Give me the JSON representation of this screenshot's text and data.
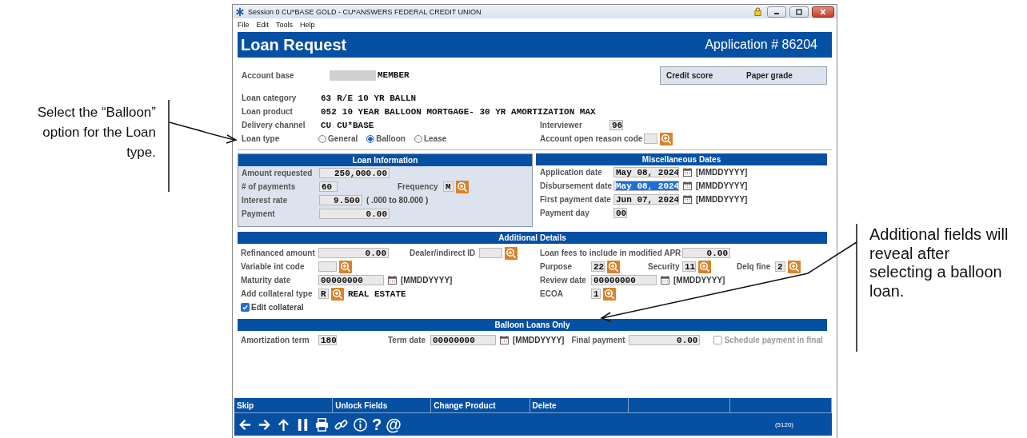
{
  "callouts": [
    {
      "text": "Select the “Balloon” option for the Loan type."
    },
    {
      "text": "Additional fields will reveal after selecting a balloon loan."
    }
  ],
  "window": {
    "title": "Session 0 CU*BASE GOLD - CU*ANSWERS FEDERAL CREDIT UNION",
    "menu": [
      "File",
      "Edit",
      "Tools",
      "Help"
    ]
  },
  "header": {
    "title": "Loan Request",
    "application": "Application # 86204"
  },
  "account_base": {
    "label": "Account base",
    "value": "MEMBER"
  },
  "credit_panel": [
    "Credit score",
    "Paper grade"
  ],
  "loan_category": {
    "label": "Loan category",
    "code": "63",
    "name": "R/E 10 YR BALLN"
  },
  "loan_product": {
    "label": "Loan product",
    "code": "052",
    "name": "10 YEAR BALLOON MORTGAGE- 30 YR AMORTIZATION MAX"
  },
  "delivery_channel": {
    "label": "Delivery channel",
    "code": "CU",
    "name": "CU*BASE"
  },
  "interviewer": {
    "label": "Interviewer",
    "value": "96"
  },
  "loan_type": {
    "label": "Loan type",
    "options": [
      {
        "label": "General",
        "selected": false
      },
      {
        "label": "Balloon",
        "selected": true
      },
      {
        "label": "Lease",
        "selected": false
      }
    ]
  },
  "account_open_reason": {
    "label": "Account open reason code"
  },
  "loan_information": {
    "title": "Loan Information",
    "amount_requested": {
      "label": "Amount requested",
      "value": "250,000.00"
    },
    "payments": {
      "label": "# of payments",
      "value": "60"
    },
    "frequency": {
      "label": "Frequency",
      "value": "M"
    },
    "interest_rate": {
      "label": "Interest rate",
      "value": "9.500",
      "range": "( .000 to 80.000 )"
    },
    "payment": {
      "label": "Payment",
      "value": "0.00"
    }
  },
  "miscellaneous_dates": {
    "title": "Miscellaneous Dates",
    "rows": [
      {
        "label": "Application date",
        "value": "May 08, 2024",
        "format": "[MMDDYYYY]",
        "selected": false
      },
      {
        "label": "Disbursement date",
        "value": "May 08, 2024",
        "format": "[MMDDYYYY]",
        "selected": true
      },
      {
        "label": "First payment date",
        "value": "Jun 07, 2024",
        "format": "[MMDDYYYY]",
        "selected": false
      }
    ],
    "payment_day": {
      "label": "Payment day",
      "value": "00"
    }
  },
  "additional_details": {
    "title": "Additional Details",
    "refinanced_amount": {
      "label": "Refinanced amount",
      "value": "0.00"
    },
    "dealer_id": {
      "label": "Dealer/indirect ID"
    },
    "loan_fees": {
      "label": "Loan fees to include in modified APR",
      "value": "0.00"
    },
    "variable_int_code": {
      "label": "Variable int code"
    },
    "purpose": {
      "label": "Purpose",
      "value": "22"
    },
    "security": {
      "label": "Security",
      "value": "11"
    },
    "delq_fine": {
      "label": "Delq fine",
      "value": "2"
    },
    "maturity_date": {
      "label": "Maturity date",
      "value": "00000000",
      "format": "[MMDDYYYY]"
    },
    "review_date": {
      "label": "Review date",
      "value": "00000000",
      "format": "[MMDDYYYY]"
    },
    "collateral_type": {
      "label": "Add collateral type",
      "value": "R",
      "description": "REAL ESTATE"
    },
    "ecoa": {
      "label": "ECOA",
      "value": "1"
    },
    "edit_collateral": {
      "label": "Edit collateral",
      "checked": true
    }
  },
  "balloon_loans": {
    "title": "Balloon Loans Only",
    "amortization_term": {
      "label": "Amortization term",
      "value": "180"
    },
    "term_date": {
      "label": "Term date",
      "value": "00000000",
      "format": "[MMDDYYYY]"
    },
    "final_payment": {
      "label": "Final payment",
      "value": "0.00"
    },
    "schedule_payment": {
      "label": "Schedule payment in final",
      "checked": false,
      "disabled": true
    }
  },
  "function_keys": [
    "Skip",
    "Unlock Fields",
    "Change Product",
    "Delete"
  ],
  "toolbar_glyphs": [
    "?",
    "@"
  ],
  "status_code": "(5120)"
}
